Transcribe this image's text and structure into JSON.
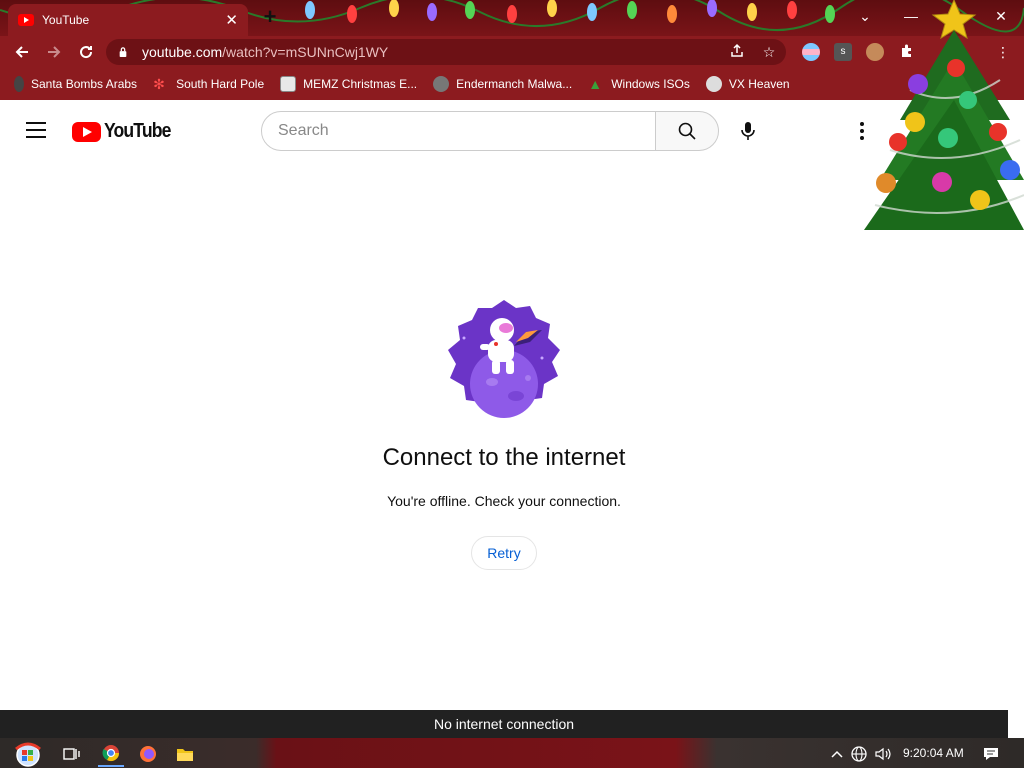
{
  "browser": {
    "tab": {
      "title": "YouTube"
    },
    "url": {
      "host": "youtube.com",
      "path": "/watch?v=mSUNnCwj1WY"
    },
    "bookmarks": [
      {
        "label": "Santa Bombs Arabs",
        "icon": "pin-icon"
      },
      {
        "label": "South Hard Pole",
        "icon": "snowflake-icon"
      },
      {
        "label": "MEMZ Christmas E...",
        "icon": "memz-icon"
      },
      {
        "label": "Endermanch Malwa...",
        "icon": "wolf-icon"
      },
      {
        "label": "Windows ISOs",
        "icon": "tree-icon"
      },
      {
        "label": "VX Heaven",
        "icon": "skull-icon"
      }
    ]
  },
  "youtube": {
    "logo_text": "YouTube",
    "search_placeholder": "Search"
  },
  "offline": {
    "title": "Connect to the internet",
    "subtitle": "You're offline. Check your connection.",
    "retry_label": "Retry",
    "banner": "No internet connection"
  },
  "taskbar": {
    "clock": "9:20:04 AM"
  },
  "colors": {
    "browser_frame": "#8c1b1f",
    "youtube_red": "#ff0000",
    "link_blue": "#065fd4",
    "offline_bar": "#212121",
    "art_purple": "#6b34c7"
  }
}
